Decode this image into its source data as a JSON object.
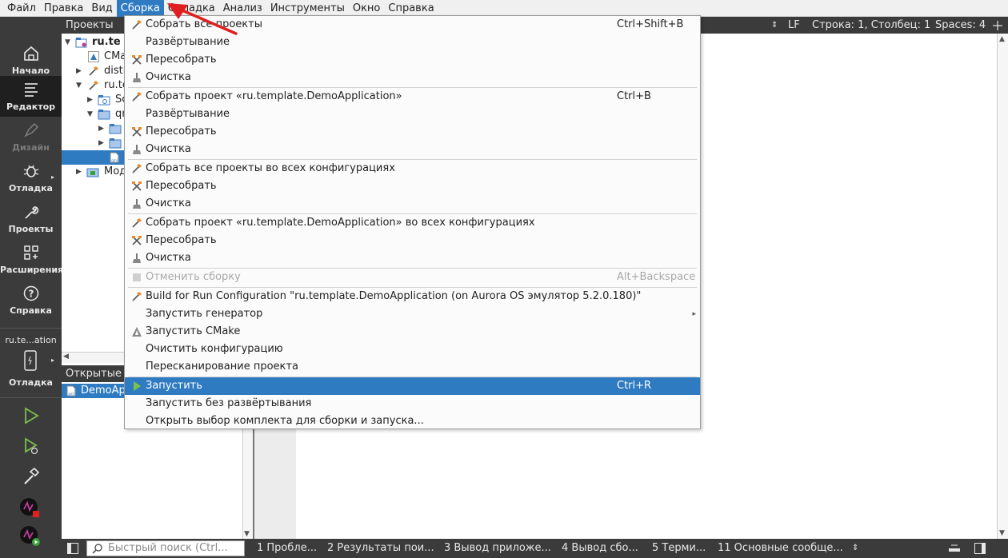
{
  "menubar": {
    "items": [
      "Файл",
      "Правка",
      "Вид",
      "Сборка",
      "Отладка",
      "Анализ",
      "Инструменты",
      "Окно",
      "Справка"
    ],
    "active": "Сборка"
  },
  "modes": [
    {
      "label": "Начало",
      "icon": "home-icon"
    },
    {
      "label": "Редактор",
      "icon": "editor-icon"
    },
    {
      "label": "Дизайн",
      "icon": "design-icon"
    },
    {
      "label": "Отладка",
      "icon": "debug-icon"
    },
    {
      "label": "Проекты",
      "icon": "wrench-icon"
    },
    {
      "label": "Расширения",
      "icon": "extensions-icon"
    },
    {
      "label": "Справка",
      "icon": "help-icon"
    }
  ],
  "kit": {
    "name": "ru.te...ation",
    "mode": "Отладка"
  },
  "projects_panel": {
    "title": "Проекты",
    "rows": [
      "ru.te",
      "CMa",
      "distr",
      "ru.te",
      "So",
      "qr",
      "",
      "",
      "",
      "Мод"
    ]
  },
  "open_docs": {
    "title": "Открытые д",
    "item": "DemoAp"
  },
  "editor_toolbar": {
    "line_ending": "LF",
    "position": "Строка: 1, Столбец: 1",
    "spaces": "Spaces: 4"
  },
  "build_menu": {
    "items": [
      {
        "label": "Собрать все проекты",
        "shortcut": "Ctrl+Shift+B",
        "icon": "hammer-icon"
      },
      {
        "label": "Развёртывание",
        "shortcut": "",
        "icon": ""
      },
      {
        "label": "Пересобрать",
        "shortcut": "",
        "icon": "rebuild-icon"
      },
      {
        "label": "Очистка",
        "shortcut": "",
        "icon": "broom-icon"
      },
      {
        "label": "Собрать проект «ru.template.DemoApplication»",
        "shortcut": "Ctrl+B",
        "icon": "hammer-icon"
      },
      {
        "label": "Развёртывание",
        "shortcut": "",
        "icon": ""
      },
      {
        "label": "Пересобрать",
        "shortcut": "",
        "icon": "rebuild-icon"
      },
      {
        "label": "Очистка",
        "shortcut": "",
        "icon": "broom-icon"
      },
      {
        "label": "Собрать все проекты во всех конфигурациях",
        "shortcut": "",
        "icon": "hammer-icon"
      },
      {
        "label": "Пересобрать",
        "shortcut": "",
        "icon": "rebuild-icon"
      },
      {
        "label": "Очистка",
        "shortcut": "",
        "icon": "broom-icon"
      },
      {
        "label": "Собрать проект «ru.template.DemoApplication» во всех конфигурациях",
        "shortcut": "",
        "icon": "hammer-icon"
      },
      {
        "label": "Пересобрать",
        "shortcut": "",
        "icon": "rebuild-icon"
      },
      {
        "label": "Очистка",
        "shortcut": "",
        "icon": "broom-icon"
      },
      {
        "label": "Отменить сборку",
        "shortcut": "Alt+Backspace",
        "icon": "stop-icon"
      },
      {
        "label": "Build for Run Configuration \"ru.template.DemoApplication (on Aurora OS эмулятор 5.2.0.180)\"",
        "shortcut": "",
        "icon": "hammer-icon"
      },
      {
        "label": "Запустить генератор",
        "shortcut": "",
        "icon": ""
      },
      {
        "label": "Запустить CMake",
        "shortcut": "",
        "icon": "cmake-icon"
      },
      {
        "label": "Очистить конфигурацию",
        "shortcut": "",
        "icon": ""
      },
      {
        "label": "Пересканирование проекта",
        "shortcut": "",
        "icon": ""
      },
      {
        "label": "Запустить",
        "shortcut": "Ctrl+R",
        "icon": "run-icon"
      },
      {
        "label": "Запустить без развёртывания",
        "shortcut": "",
        "icon": ""
      },
      {
        "label": "Открыть выбор комплекта для сборки и запуска...",
        "shortcut": "",
        "icon": ""
      }
    ]
  },
  "statusbar": {
    "search_placeholder": "Быстрый поиск (Ctrl...",
    "tabs": [
      "1  Пробле...",
      "2  Результаты пои...",
      "3  Вывод приложе...",
      "4  Вывод сбо...",
      "5  Терми...",
      "11 Основные сообще..."
    ]
  },
  "colors": {
    "accent": "#2f7bc2",
    "sidebar": "#3b3b3b",
    "arrow": "#e02020"
  }
}
